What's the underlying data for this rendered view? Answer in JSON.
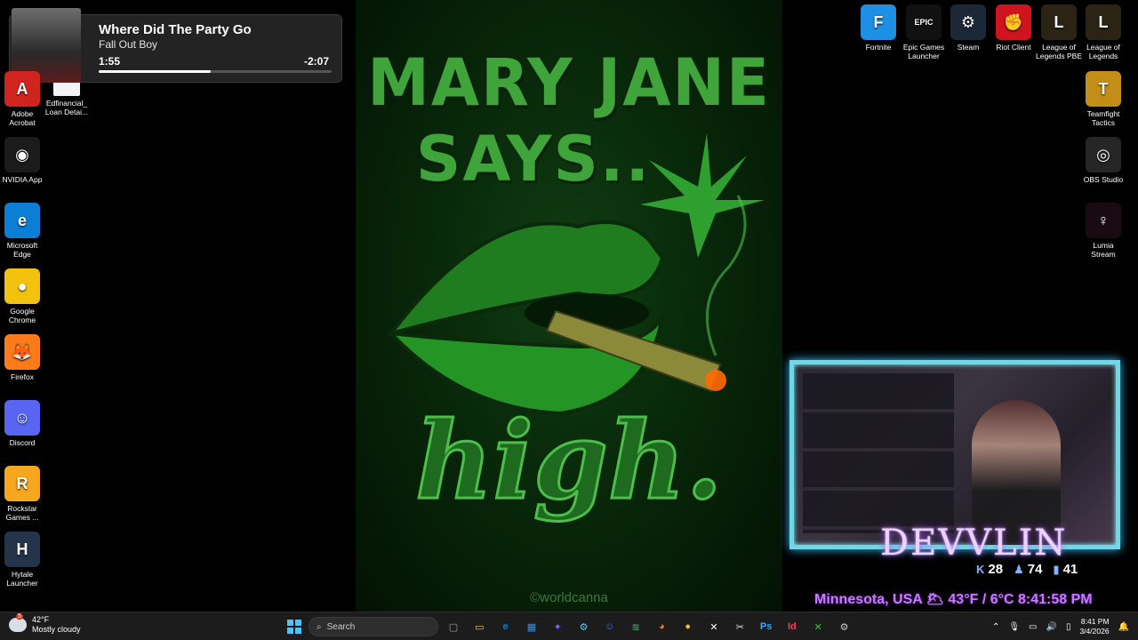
{
  "wallpaper": {
    "line1": "MARY JANE",
    "line2": "SAYS..",
    "word": "high.",
    "credit": "©worldcanna"
  },
  "desktop_left": [
    {
      "label": "Adobe Acrobat",
      "icon": "acrobat-icon",
      "color": "#d0251f",
      "glyph": "A"
    },
    {
      "label": "NVIDIA App",
      "icon": "nvidia-icon",
      "color": "#1b1b1b",
      "glyph": "◉"
    },
    {
      "label": "Microsoft Edge",
      "icon": "edge-icon",
      "color": "#0c7ed6",
      "glyph": "e"
    },
    {
      "label": "Google Chrome",
      "icon": "chrome-icon",
      "color": "#f2c20f",
      "glyph": "●"
    },
    {
      "label": "Firefox",
      "icon": "firefox-icon",
      "color": "#ff7b1a",
      "glyph": "🦊"
    },
    {
      "label": "Discord",
      "icon": "discord-icon",
      "color": "#5865f2",
      "glyph": "☺"
    },
    {
      "label": "Rockstar Games ...",
      "icon": "rockstar-icon",
      "color": "#f5a81e",
      "glyph": "R"
    },
    {
      "label": "Hytale Launcher",
      "icon": "hytale-icon",
      "color": "#24344a",
      "glyph": "H"
    }
  ],
  "desktop_second": {
    "label": "Edfinancial_ Loan Detai...",
    "icon": "pdf-icon",
    "glyph": "PDF"
  },
  "desktop_right_top": [
    {
      "label": "Fortnite",
      "icon": "fortnite-icon",
      "color": "#1d8fe5",
      "glyph": "F"
    },
    {
      "label": "Epic Games Launcher",
      "icon": "epic-games-icon",
      "color": "#111111",
      "glyph": "EPIC"
    },
    {
      "label": "Steam",
      "icon": "steam-icon",
      "color": "#1b2838",
      "glyph": "⚙"
    },
    {
      "label": "Riot Client",
      "icon": "riot-icon",
      "color": "#d0141f",
      "glyph": "✊"
    },
    {
      "label": "League of Legends PBE",
      "icon": "league-pbe-icon",
      "color": "#2b2414",
      "glyph": "L"
    },
    {
      "label": "League of Legends",
      "icon": "league-icon",
      "color": "#2b2414",
      "glyph": "L"
    }
  ],
  "desktop_right_col": [
    {
      "label": "Teamfight Tactics",
      "icon": "tft-icon",
      "color": "#c28e17",
      "glyph": "T"
    },
    {
      "label": "OBS Studio",
      "icon": "obs-icon",
      "color": "#262626",
      "glyph": "◎"
    },
    {
      "label": "Lumia Stream",
      "icon": "lumia-icon",
      "color": "#1a0a12",
      "glyph": "♀"
    }
  ],
  "media": {
    "title": "Where Did The Party Go",
    "artist": "Fall Out Boy",
    "elapsed": "1:55",
    "remaining": "-2:07",
    "progress": 0.48
  },
  "stream": {
    "name": "DEVVLIN",
    "stat1": "28",
    "stat2": "74",
    "stat3": "41",
    "info": "Minnesota, USA 🌥 43°F / 6°C  8:41:58 PM"
  },
  "taskbar": {
    "weather_temp": "42°F",
    "weather_desc": "Mostly cloudy",
    "weather_badge": "5",
    "search_placeholder": "Search",
    "apps": [
      {
        "name": "task-view-icon",
        "color": "#9aa0a6",
        "glyph": "▢"
      },
      {
        "name": "file-explorer-icon",
        "color": "#f5c542",
        "glyph": "▭"
      },
      {
        "name": "edge-taskbar-icon",
        "color": "#0c7ed6",
        "glyph": "e"
      },
      {
        "name": "store-icon",
        "color": "#3b8fd8",
        "glyph": "▦"
      },
      {
        "name": "copilot-icon",
        "color": "#7b61ff",
        "glyph": "✦"
      },
      {
        "name": "steam-taskbar-icon",
        "color": "#66c0f4",
        "glyph": "⚙"
      },
      {
        "name": "discord-taskbar-icon",
        "color": "#5865f2",
        "glyph": "☺"
      },
      {
        "name": "spotify-icon",
        "color": "#1db954",
        "glyph": "≋"
      },
      {
        "name": "firefox-taskbar-icon",
        "color": "#ff7b1a",
        "glyph": "◕"
      },
      {
        "name": "chrome-taskbar-icon",
        "color": "#f2c20f",
        "glyph": "●"
      },
      {
        "name": "xbox-icon",
        "color": "#ffffff",
        "glyph": "✕"
      },
      {
        "name": "snipping-icon",
        "color": "#e0e0e0",
        "glyph": "✂"
      },
      {
        "name": "photoshop-icon",
        "color": "#31a8ff",
        "glyph": "Ps"
      },
      {
        "name": "indesign-icon",
        "color": "#ff3366",
        "glyph": "Id"
      },
      {
        "name": "xbox-app-icon",
        "color": "#2ecc40",
        "glyph": "✕"
      },
      {
        "name": "settings-icon",
        "color": "#cccccc",
        "glyph": "⚙"
      }
    ],
    "time": "8:41 PM",
    "date": "3/4/2026"
  }
}
